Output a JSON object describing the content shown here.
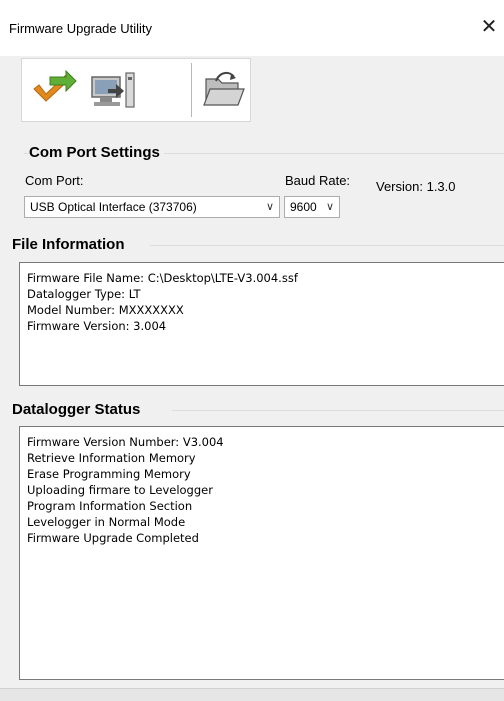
{
  "window": {
    "title": "Firmware Upgrade Utility",
    "close_symbol": "✕"
  },
  "toolbar": {
    "buttons": [
      {
        "name": "upgrade-firmware",
        "icon": "check-arrow-icon"
      },
      {
        "name": "connect-computer",
        "icon": "computer-arrow-icon"
      },
      {
        "name": "open-file",
        "icon": "folder-open-icon"
      }
    ]
  },
  "com_port_settings": {
    "title": "Com Port Settings",
    "com_port_label": "Com Port:",
    "com_port_value": "USB Optical Interface (373706)",
    "baud_rate_label": "Baud Rate:",
    "baud_rate_value": "9600",
    "version_text": "Version: 1.3.0"
  },
  "file_information": {
    "title": "File Information",
    "lines": [
      "Firmware File Name: C:\\Desktop\\LTE-V3.004.ssf",
      "Datalogger Type: LT",
      "Model Number: MXXXXXXX",
      "Firmware Version: 3.004"
    ]
  },
  "datalogger_status": {
    "title": "Datalogger Status",
    "lines": [
      "Firmware Version Number: V3.004",
      "Retrieve Information Memory",
      "Erase Programming Memory",
      "Uploading firmare to Levelogger",
      "Program Information Section",
      "Levelogger in Normal Mode",
      "Firmware Upgrade Completed"
    ]
  },
  "colors": {
    "window_bg": "#f0f0f0",
    "text_bg": "#ffffff",
    "border": "#7a7a7a"
  }
}
